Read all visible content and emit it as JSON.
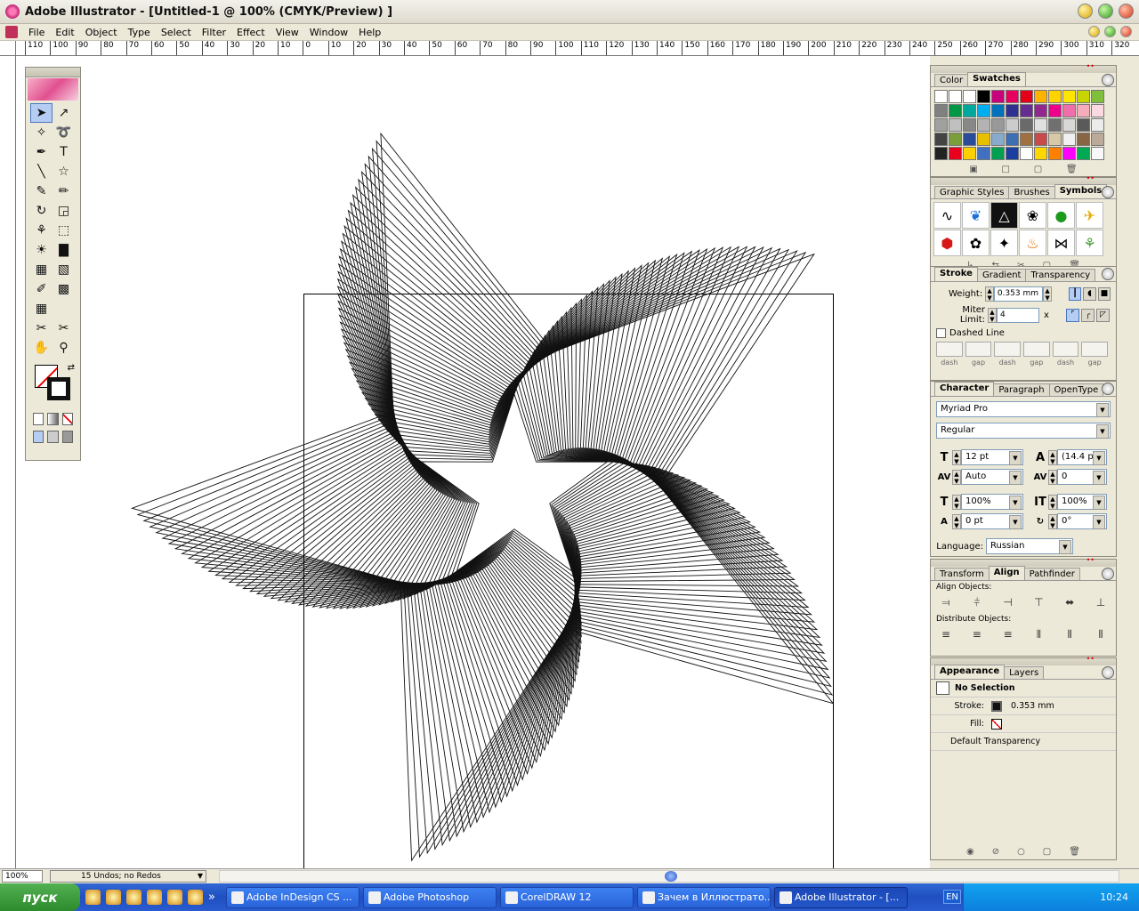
{
  "window": {
    "title": "Adobe Illustrator - [Untitled-1 @ 100% (CMYK/Preview) ]"
  },
  "menu": [
    "File",
    "Edit",
    "Object",
    "Type",
    "Select",
    "Filter",
    "Effect",
    "View",
    "Window",
    "Help"
  ],
  "ruler": {
    "ticks": [
      "110",
      "100",
      "90",
      "80",
      "70",
      "60",
      "50",
      "40",
      "30",
      "20",
      "10",
      "0",
      "10",
      "20",
      "30",
      "40",
      "50",
      "60",
      "70",
      "80",
      "90",
      "100",
      "110",
      "120",
      "130",
      "140",
      "150",
      "160",
      "170",
      "180",
      "190",
      "200",
      "210",
      "220",
      "230",
      "240",
      "250",
      "260",
      "270",
      "280",
      "290",
      "300",
      "310",
      "320"
    ]
  },
  "swatches_panel": {
    "tabs": [
      "Color",
      "Swatches"
    ],
    "active": "Swatches",
    "colors": [
      "#ffffff",
      "#ffffff",
      "#ffffff",
      "#000000",
      "#c8007a",
      "#e80060",
      "#e5001a",
      "#ffb300",
      "#ffd200",
      "#ffe600",
      "#c8d400",
      "#7fbf3c",
      "#808080",
      "#009846",
      "#00a99d",
      "#00aeef",
      "#0072bc",
      "#2e3192",
      "#662d91",
      "#92278f",
      "#ec008c",
      "#f06eaa",
      "#f7acbc",
      "#fbd9e3",
      "#a0a0a0",
      "#c0c0c0",
      "#888888",
      "#b3b3b3",
      "#999999",
      "#cccccc",
      "#6a6a6a",
      "#e0e0e0",
      "#707070",
      "#d8d8d8",
      "#5a5a5a",
      "#ececec",
      "#444444",
      "#7a9e3a",
      "#2a4a9a",
      "#e8c000",
      "#88aacc",
      "#3d6fb4",
      "#a07040",
      "#c84a4a",
      "#d9c8a8",
      "#f0f0f0",
      "#886644",
      "#bbaa99",
      "#222222",
      "#e8001c",
      "#ffd000",
      "#4070c0",
      "#00a050",
      "#1a3fa0",
      "#ffffff",
      "#ffd700",
      "#ff7f00",
      "#ff00ff",
      "#00aa55",
      "#f8f8f8"
    ]
  },
  "symbols_panel": {
    "tabs": [
      "Graphic Styles",
      "Brushes",
      "Symbols"
    ],
    "active": "Symbols",
    "items": [
      "swoosh-symbol",
      "butterfly-symbol",
      "triangle-symbol",
      "grapes-symbol",
      "apple-symbol",
      "fish-gold-symbol",
      "shield-symbol",
      "knot-symbol",
      "flower-symbol",
      "flame-symbol",
      "fish-symbol",
      "grass-symbol"
    ]
  },
  "stroke_panel": {
    "tabs": [
      "Stroke",
      "Gradient",
      "Transparency"
    ],
    "active": "Stroke",
    "weight_label": "Weight:",
    "weight": "0.353 mm",
    "miter_label": "Miter Limit:",
    "miter": "4",
    "miter_unit": "x",
    "dashed_label": "Dashed Line",
    "dash_labels": [
      "dash",
      "gap",
      "dash",
      "gap",
      "dash",
      "gap"
    ]
  },
  "character_panel": {
    "tabs": [
      "Character",
      "Paragraph",
      "OpenType"
    ],
    "active": "Character",
    "font": "Myriad Pro",
    "style": "Regular",
    "size": "12 pt",
    "leading": "(14.4 pt)",
    "kerning": "Auto",
    "tracking": "0",
    "hscale": "100%",
    "vscale": "100%",
    "baseline": "0 pt",
    "rotation": "0°",
    "language_label": "Language:",
    "language": "Russian"
  },
  "align_panel": {
    "tabs": [
      "Transform",
      "Align",
      "Pathfinder"
    ],
    "active": "Align",
    "align_label": "Align Objects:",
    "distribute_label": "Distribute Objects:"
  },
  "appearance_panel": {
    "tabs": [
      "Appearance",
      "Layers"
    ],
    "active": "Appearance",
    "selection": "No Selection",
    "stroke_label": "Stroke:",
    "stroke_value": "0.353 mm",
    "fill_label": "Fill:",
    "transparency": "Default Transparency"
  },
  "status": {
    "zoom": "100%",
    "info": "15 Undos; no Redos"
  },
  "taskbar": {
    "start": "пуск",
    "tasks": [
      "Adobe InDesign CS ...",
      "Adobe Photoshop",
      "CorelDRAW 12",
      "Зачем в Иллюстрато...",
      "Adobe Illustrator - [..."
    ],
    "active_task": 4,
    "lang": "EN",
    "time": "10:24"
  }
}
